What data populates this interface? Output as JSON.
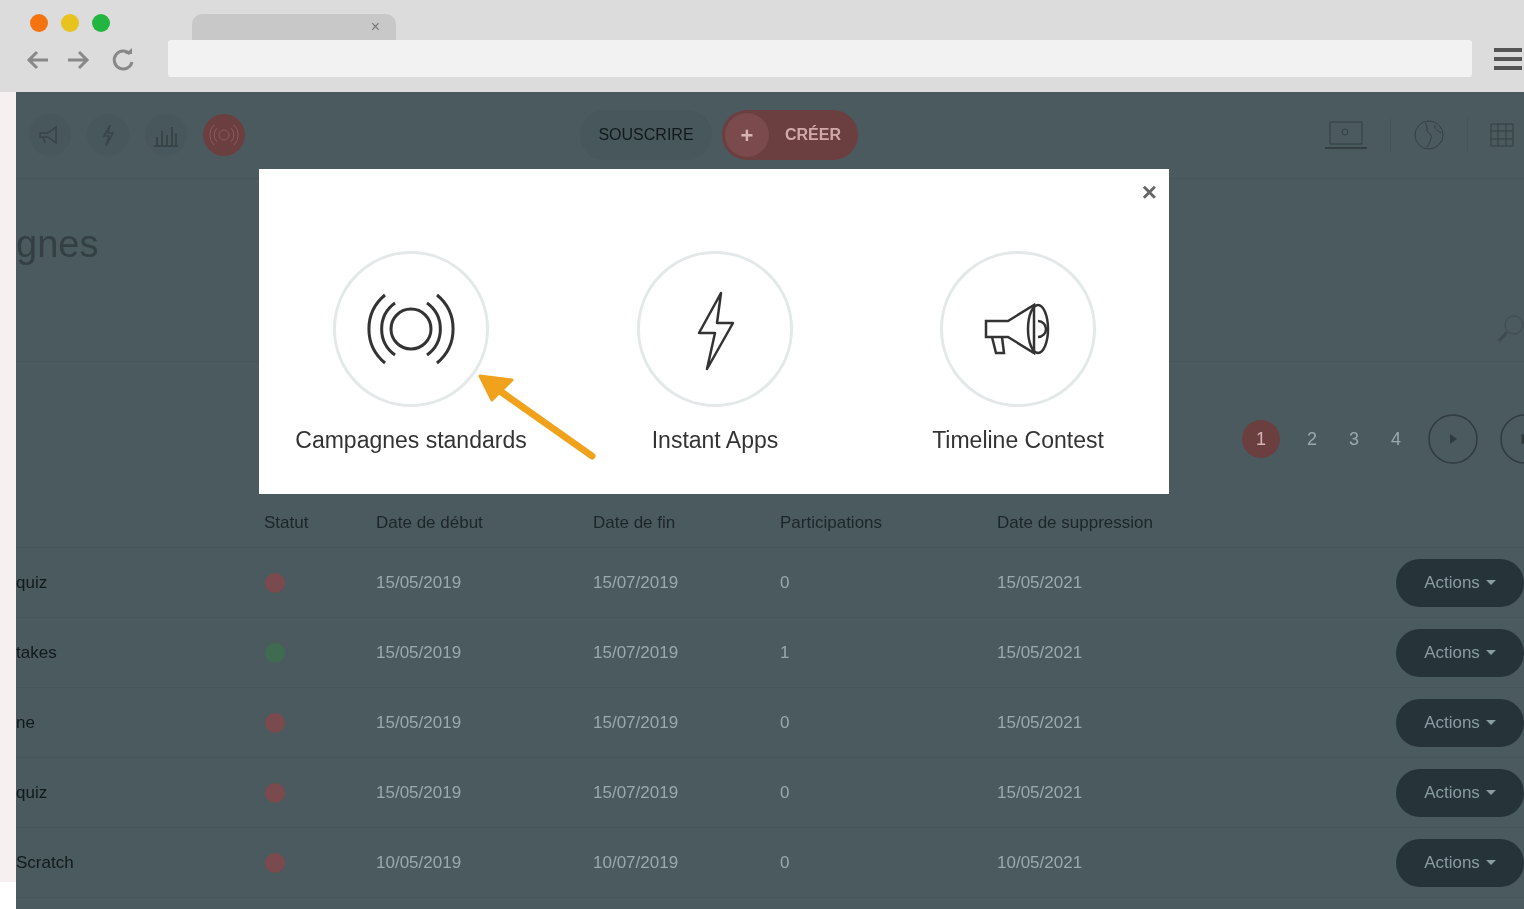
{
  "browser": {
    "tab": {
      "close": "×"
    }
  },
  "toolbar": {
    "buttons": [
      {
        "label": "SOUSCRIRE",
        "kind": "outline"
      },
      {
        "label": "CRÉER",
        "kind": "create",
        "icon": "+"
      }
    ]
  },
  "page": {
    "title": "gnes"
  },
  "pagination": {
    "pages": [
      {
        "label": "1",
        "selected": true
      },
      {
        "label": "2",
        "selected": false
      },
      {
        "label": "3",
        "selected": false
      },
      {
        "label": "4",
        "selected": false
      }
    ]
  },
  "table": {
    "columns": [
      "Statut",
      "Date de début",
      "Date de fin",
      "Participations",
      "Date de suppression"
    ],
    "rows": [
      {
        "name": "quiz",
        "color": "#7a4a4c",
        "start": "15/05/2019",
        "end": "15/07/2019",
        "participations": "0",
        "deletion": "15/05/2021",
        "action": "Actions"
      },
      {
        "name": "takes",
        "color": "#3f6b50",
        "start": "15/05/2019",
        "end": "15/07/2019",
        "participations": "1",
        "deletion": "15/05/2021",
        "action": "Actions"
      },
      {
        "name": "ne",
        "color": "#7a4a4c",
        "start": "15/05/2019",
        "end": "15/07/2019",
        "participations": "0",
        "deletion": "15/05/2021",
        "action": "Actions"
      },
      {
        "name": "quiz",
        "color": "#7a4a4c",
        "start": "15/05/2019",
        "end": "15/07/2019",
        "participations": "0",
        "deletion": "15/05/2021",
        "action": "Actions"
      },
      {
        "name": "Scratch",
        "color": "#7a4a4c",
        "start": "10/05/2019",
        "end": "10/07/2019",
        "participations": "0",
        "deletion": "10/05/2021",
        "action": "Actions"
      }
    ]
  },
  "modal": {
    "close": "×",
    "options": [
      {
        "label": "Campagnes standards",
        "kind": "broadcast"
      },
      {
        "label": "Instant Apps",
        "kind": "lightning"
      },
      {
        "label": "Timeline Contest",
        "kind": "megaphone"
      }
    ]
  }
}
